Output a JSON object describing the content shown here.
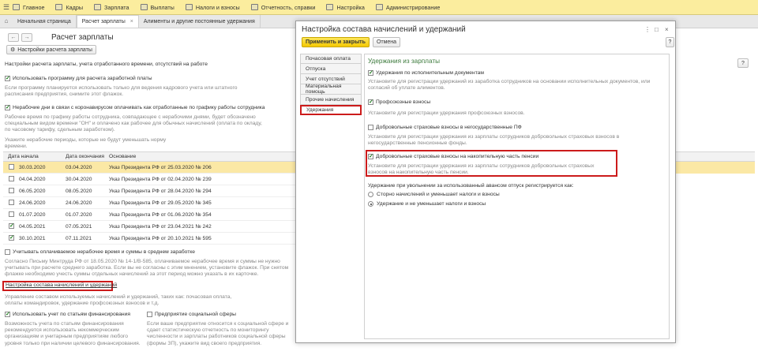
{
  "topbar": {
    "items": [
      {
        "label": "Главное",
        "icon": "home-menu-icon"
      },
      {
        "label": "Кадры",
        "icon": "staff-icon"
      },
      {
        "label": "Зарплата",
        "icon": "salary-icon"
      },
      {
        "label": "Выплаты",
        "icon": "payments-icon"
      },
      {
        "label": "Налоги и взносы",
        "icon": "taxes-icon"
      },
      {
        "label": "Отчетность, справки",
        "icon": "reports-icon"
      },
      {
        "label": "Настройка",
        "icon": "settings-icon"
      },
      {
        "label": "Администрирование",
        "icon": "admin-icon"
      }
    ]
  },
  "tabs": [
    {
      "label": "Начальная страница"
    },
    {
      "label": "Расчет зарплаты"
    },
    {
      "label": "Алименты и другие постоянные удержания"
    }
  ],
  "main": {
    "title": "Расчет зарплаты",
    "settings_button": "Настройки расчета зарплаты",
    "subtitle": "Настройки расчета зарплаты, учета отработанного времени, отсутствий на работе",
    "use_program_label": "Использовать программу для расчета заработной платы",
    "use_program_hint": "Если программу планируется использовать только для ведения кадрового учета или штатного расписания предприятия, снимите этот флажок.",
    "covid_label": "Нерабочие дни в связи с коронавирусом оплачивать как отработанные по графику работы сотрудника",
    "covid_hint": "Рабочее время по графику работы сотрудника, совпадающее с нерабочими днями, будет обозначено специальным видом времени \"ОН\" и оплачено как рабочее для обычных начислений (оплата по окладу, по часовому тарифу, сдельным заработком).",
    "periods_hint": "Укажите нерабочие периоды, которые не будут уменьшать норму времени.",
    "table": {
      "headers": [
        "Дата начала",
        "Дата окончания",
        "Основание"
      ],
      "rows": [
        {
          "start": "30.03.2020",
          "end": "03.04.2020",
          "basis": "Указ Президента РФ от 25.03.2020 № 206",
          "checked": false,
          "selected": true
        },
        {
          "start": "04.04.2020",
          "end": "30.04.2020",
          "basis": "Указ Президента РФ от 02.04.2020 № 239",
          "checked": false,
          "selected": false
        },
        {
          "start": "06.05.2020",
          "end": "08.05.2020",
          "basis": "Указ Президента РФ от 28.04.2020 № 294",
          "checked": false,
          "selected": false
        },
        {
          "start": "24.06.2020",
          "end": "24.06.2020",
          "basis": "Указ Президента РФ от 29.05.2020 № 345",
          "checked": false,
          "selected": false
        },
        {
          "start": "01.07.2020",
          "end": "01.07.2020",
          "basis": "Указ Президента РФ от 01.06.2020 № 354",
          "checked": false,
          "selected": false
        },
        {
          "start": "04.05.2021",
          "end": "07.05.2021",
          "basis": "Указ Президента РФ от 23.04.2021 № 242",
          "checked": true,
          "selected": false
        },
        {
          "start": "30.10.2021",
          "end": "07.11.2021",
          "basis": "Указ Президента РФ от 20.10.2021 № 595",
          "checked": true,
          "selected": false
        }
      ]
    },
    "average_label": "Учитывать оплачиваемое нерабочее время и суммы в среднем заработке",
    "average_hint": "Согласно Письму Минтруда РФ от 18.05.2020 № 14-1/В-585, оплачиваемое нерабочее время и суммы не нужно учитывать при расчете среднего заработка. Если вы не согласны с этим мнением, установите флажок. При снятом флажке необходимо учесть суммы отдельных начислений за этот период можно указать в их карточке.",
    "composition_link": "Настройка состава начислений и удержаний",
    "composition_hint": "Управление составом используемых начислений и удержаний, таких как: почасовая оплата, оплаты командировок, удержание профсоюзных взносов и т.д.",
    "funding_label": "Использовать учет по статьям финансирования",
    "funding_hint": "Возможность учета по статьям финансирования рекомендуется использовать некоммерческим организациям и унитарным предприятиям любого уровня только при наличии целевого финансирования.",
    "social_label": "Предприятие социальной сферы",
    "social_hint": "Если ваше предприятие относится к социальной сфере и сдает статистическую отчетность по мониторингу численности и зарплаты работников социальной сферы (формы ЗП), укажите вид своего предприятия."
  },
  "modal": {
    "title": "Настройка состава начислений и удержаний",
    "apply_button": "Применить и закрыть",
    "cancel_button": "Отмена",
    "nav": [
      "Почасовая оплата",
      "Отпуска",
      "Учет отсутствий",
      "Материальная помощь",
      "Прочие начисления",
      "Удержания"
    ],
    "active_nav": 5,
    "section_title": "Удержания из зарплаты",
    "options": [
      {
        "label": "Удержания по исполнительным документам",
        "checked": true,
        "hint": "Установите для регистрации удержаний из заработка сотрудников на основании исполнительных документов, или согласий об уплате алиментов."
      },
      {
        "label": "Профсоюзные взносы",
        "checked": true,
        "hint": "Установите для регистрации удержания профсоюзных взносов."
      },
      {
        "label": "Добровольные страховые взносы в негосударственные ПФ",
        "checked": false,
        "hint": "Установите для регистрации удержания из зарплаты сотрудников добровольных страховых взносов в негосударственные пенсионные фонды."
      },
      {
        "label": "Добровольные страховые взносы на накопительную часть пенсии",
        "checked": true,
        "hint": "Установите для регистрации удержания из зарплаты сотрудников добровольных страховых взносов на накопительную часть пенсии."
      }
    ],
    "vacation_title": "Удержание при увольнении за использованный авансом отпуск регистрируется как:",
    "radios": [
      {
        "label": "Сторно начислений и уменьшает налоги и взносы",
        "on": false
      },
      {
        "label": "Удержание и не уменьшает налоги и взносы",
        "on": true
      }
    ],
    "help": "?"
  },
  "right_help": "?"
}
